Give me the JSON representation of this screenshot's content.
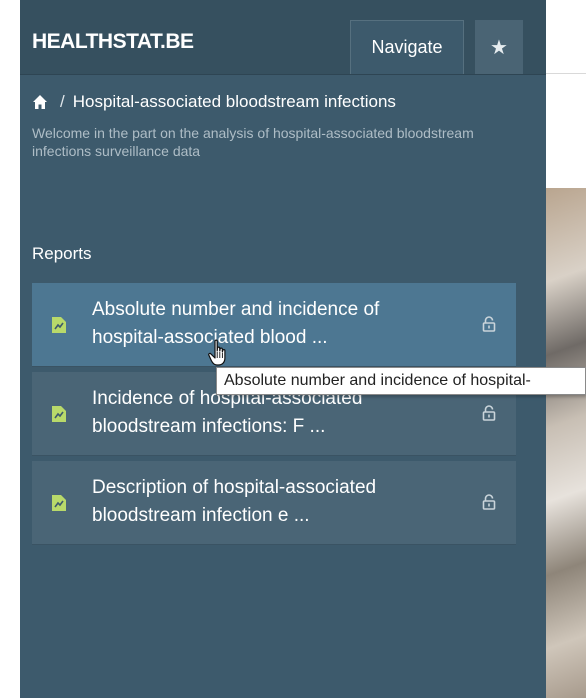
{
  "header": {
    "brand": "HEALTHSTAT.BE",
    "tabs": [
      {
        "label": "Navigate",
        "active": true
      },
      {
        "icon": "star-icon",
        "label": "★"
      }
    ]
  },
  "breadcrumb": {
    "home_icon": "home-icon",
    "separator": "/",
    "current": "Hospital-associated bloodstream infections"
  },
  "welcome_text": "Welcome in the part on the analysis of hospital-associated bloodstream infections surveillance data",
  "reports": {
    "heading": "Reports",
    "items": [
      {
        "line1": "Absolute number and incidence of",
        "line2": "hospital-associated blood ...",
        "icon": "document-chart-icon",
        "lock_icon": "lock-icon"
      },
      {
        "line1": "Incidence of hospital-associated",
        "line2": "bloodstream infections: F ...",
        "icon": "document-chart-icon",
        "lock_icon": "lock-icon"
      },
      {
        "line1": "Description of hospital-associated",
        "line2": "bloodstream infection e ...",
        "icon": "document-chart-icon",
        "lock_icon": "lock-icon"
      }
    ]
  },
  "tooltip": "Absolute number and incidence of hospital-",
  "colors": {
    "panel": "#3d5a6c",
    "active_item": "#4d7792",
    "doc_icon": "#b8d96a"
  }
}
